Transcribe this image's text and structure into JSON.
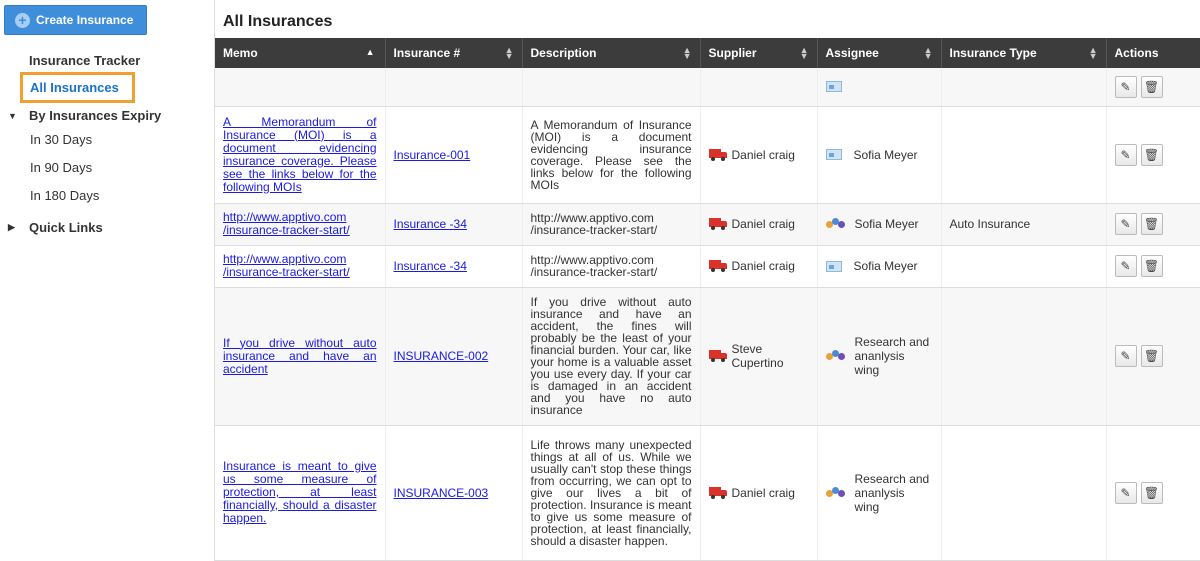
{
  "sidebar": {
    "create_button": "Create Insurance",
    "title": "Insurance Tracker",
    "active_item": "All Insurances",
    "expiry_group": "By Insurances Expiry",
    "expiry_items": [
      "In 30 Days",
      "In 90 Days",
      "In 180 Days"
    ],
    "quick_links": "Quick Links"
  },
  "main": {
    "title": "All Insurances",
    "columns": {
      "memo": "Memo",
      "number": "Insurance #",
      "description": "Description",
      "supplier": "Supplier",
      "assignee": "Assignee",
      "type": "Insurance Type",
      "actions": "Actions"
    },
    "rows": [
      {
        "memo": "",
        "number": "",
        "description": "",
        "supplier": "",
        "assignee": "",
        "assignee_icon": "id-card-icon",
        "type": ""
      },
      {
        "memo": "A Memorandum of Insurance (MOI) is a document evidencing insurance coverage. Please see the links below for the following MOIs",
        "number": "Insurance-001",
        "description": "A Memorandum of Insurance (MOI) is a document evidencing insurance coverage. Please see the links below for the following MOIs",
        "supplier": "Daniel craig",
        "assignee": "Sofia Meyer",
        "assignee_icon": "id-card-icon",
        "type": ""
      },
      {
        "memo": "http://www.apptivo.com /insurance-tracker-start/",
        "number": "Insurance -34",
        "description": "http://www.apptivo.com /insurance-tracker-start/",
        "supplier": "Daniel craig",
        "assignee": "Sofia Meyer",
        "assignee_icon": "team-icon",
        "type": "Auto Insurance"
      },
      {
        "memo": "http://www.apptivo.com /insurance-tracker-start/",
        "number": "Insurance -34",
        "description": "http://www.apptivo.com /insurance-tracker-start/",
        "supplier": "Daniel craig",
        "assignee": "Sofia Meyer",
        "assignee_icon": "id-card-icon",
        "type": ""
      },
      {
        "memo": "If you drive without auto insurance and have an accident",
        "number": "INSURANCE-002",
        "description": "If you drive without auto insurance and have an accident, the fines will probably be the least of your financial burden. Your car, like your home is a valuable asset you use every day. If your car is damaged in an accident and you have no auto insurance",
        "supplier": "Steve Cupertino",
        "assignee": "Research and ananlysis wing",
        "assignee_icon": "team-icon",
        "type": ""
      },
      {
        "memo": "Insurance is meant to give us some measure of protection, at least financially, should a disaster happen.",
        "number": "INSURANCE-003",
        "description": "Life throws many unexpected things at all of us. While we usually can't stop these things from occurring, we can opt to give our lives a bit of protection. Insurance is meant to give us some measure of protection, at least financially, should a disaster happen.",
        "supplier": "Daniel craig",
        "assignee": "Research and ananlysis wing",
        "assignee_icon": "team-icon",
        "type": ""
      }
    ]
  },
  "colors": {
    "accent": "#3f8edb",
    "highlight": "#f0a030",
    "header_bg": "#3c3c3c",
    "link": "#1a1ae0"
  }
}
